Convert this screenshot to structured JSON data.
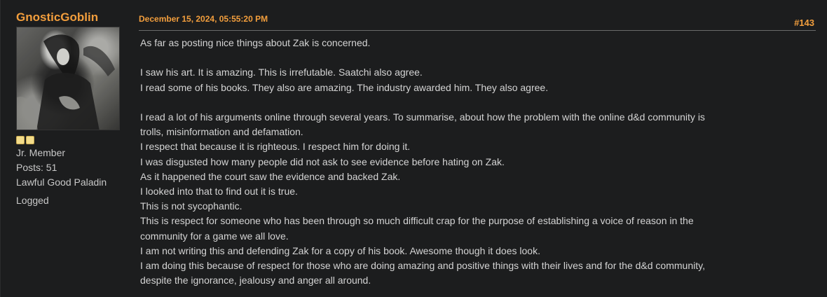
{
  "poster": {
    "username": "GnosticGoblin",
    "rank": "Jr. Member",
    "posts": "Posts: 51",
    "title": "Lawful Good Paladin",
    "logged": "Logged",
    "stars": 2
  },
  "header": {
    "date": "December 15, 2024, 05:55:20 PM",
    "post_number": "#143"
  },
  "body": {
    "lines": [
      "As far as posting nice things about Zak is concerned.",
      "",
      "I saw his art. It is amazing. This is irrefutable. Saatchi also agree.",
      "I read some of his books. They also are amazing. The industry awarded him. They also agree.",
      "",
      "I read a lot of his arguments online through several years. To summarise, about how the problem with the online d&d community is",
      "trolls, misinformation and defamation.",
      "I respect that because it is righteous. I respect him for doing it.",
      "I was disgusted how many people did not ask to see evidence before hating on Zak.",
      "As it happened the court saw the evidence and backed Zak.",
      "I looked into that to find out it is true.",
      "This is not sycophantic.",
      "This is respect for someone who has been through so much difficult crap for the purpose of establishing a voice of reason in the",
      "community for a game we all love.",
      "I am not writing this and defending Zak for a copy of his book. Awesome though it does look.",
      "I am doing this because of respect for those who are doing amazing and positive things with their lives and for the d&d community,",
      "despite the ignorance, jealousy and anger all around."
    ]
  },
  "colors": {
    "accent": "#f29e3d",
    "background": "#1c1d1e",
    "text": "#d4d4d4"
  }
}
